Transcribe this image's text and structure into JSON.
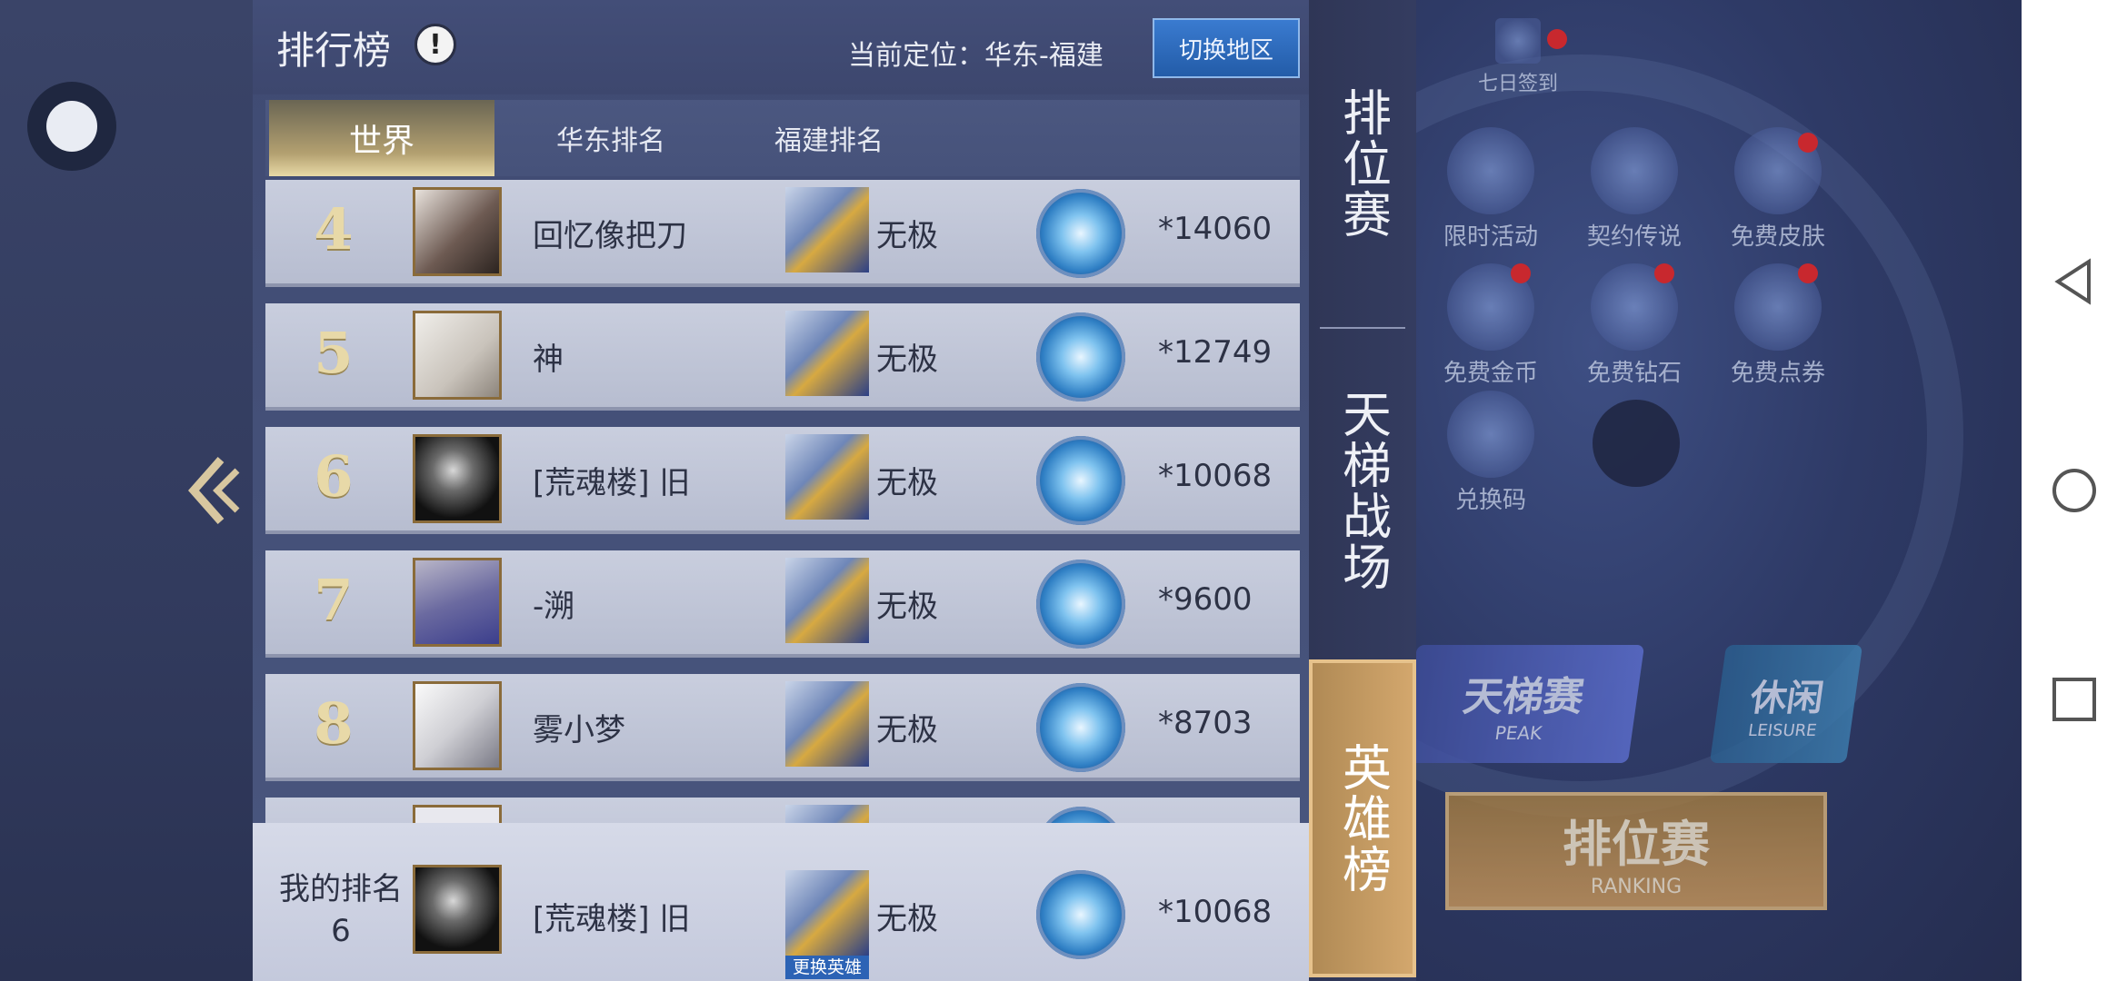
{
  "panel": {
    "title": "排行榜",
    "info_icon": "!",
    "location": "当前定位：华东-福建",
    "switch_region": "切换地区"
  },
  "tabs": [
    {
      "label": "世界",
      "active": true
    },
    {
      "label": "华东排名",
      "active": false
    },
    {
      "label": "福建排名",
      "active": false
    }
  ],
  "rows": [
    {
      "rank": "4",
      "name": "回忆像把刀",
      "hero": "无极",
      "score": "*14060"
    },
    {
      "rank": "5",
      "name": "神",
      "hero": "无极",
      "score": "*12749"
    },
    {
      "rank": "6",
      "name": "[荒魂楼] 旧",
      "hero": "无极",
      "score": "*10068"
    },
    {
      "rank": "7",
      "name": "-溯",
      "hero": "无极",
      "score": "*9600"
    },
    {
      "rank": "8",
      "name": "雾小梦",
      "hero": "无极",
      "score": "*8703"
    }
  ],
  "my_rank": {
    "label": "我的排名",
    "rank": "6",
    "name": "[荒魂楼] 旧",
    "hero": "无极",
    "change_hero": "更换英雄",
    "score": "*10068"
  },
  "side_tabs": [
    {
      "label": "排位赛",
      "active": false
    },
    {
      "label": "天梯战场",
      "active": false
    },
    {
      "label": "英雄榜",
      "active": true
    }
  ],
  "background": {
    "icons": [
      "限时活动",
      "契约传说",
      "免费皮肤",
      "免费金币",
      "免费钻石",
      "免费点券",
      "兑换码"
    ],
    "top_label": "七日签到",
    "modes": {
      "peak": "天梯赛",
      "peak_en": "PEAK",
      "leisure": "休闲",
      "leisure_en": "LEISURE",
      "ranking": "排位赛",
      "ranking_en": "RANKING"
    }
  },
  "system_nav": [
    "back-icon",
    "home-icon",
    "recents-icon"
  ]
}
